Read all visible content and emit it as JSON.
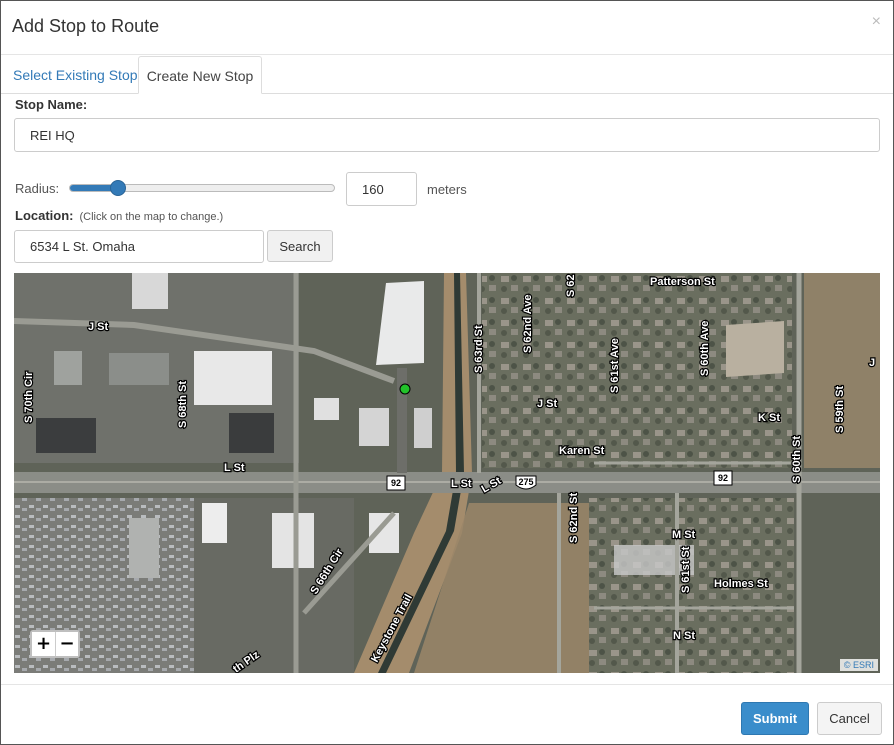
{
  "dialog": {
    "title": "Add Stop to Route",
    "close_glyph": "×"
  },
  "tabs": [
    {
      "label": "Select Existing Stop",
      "active": false
    },
    {
      "label": "Create New Stop",
      "active": true
    }
  ],
  "form": {
    "stop_name_label": "Stop Name:",
    "stop_name_value": "REI HQ",
    "radius_label": "Radius:",
    "radius_value": "160",
    "radius_fraction": 0.16,
    "radius_unit": "meters",
    "location_label": "Location:",
    "location_hint": "(Click on the map to change.)",
    "location_value": "6534 L St. Omaha",
    "search_label": "Search"
  },
  "map": {
    "zoom_in": "+",
    "zoom_out": "−",
    "attribution": "© ESRI",
    "marker_color": "#22c22a",
    "street_labels": {
      "j_st": "J St",
      "s70th": "S 70th Cir",
      "s68th": "S 68th St",
      "l_st_w": "L St",
      "l_st_e": "L St",
      "l_st_e2": "L St",
      "s63rd": "S 63rd St",
      "s62nd_ave": "S 62nd Ave",
      "s62": "S 62",
      "patterson": "Patterson St",
      "j_st_e": "J St",
      "s61st_ave": "S 61st Ave",
      "s60th_ave": "S 60th Ave",
      "k_st": "K St",
      "s59th": "S 59th St",
      "j_far": "J",
      "karen": "Karen St",
      "s60th": "S 60th St",
      "s62nd": "S 62nd St",
      "m_st": "M St",
      "s61st": "S 61st St",
      "holmes": "Holmes St",
      "n_st": "N St",
      "s66th_cir": "S 66th Cir",
      "keystone": "Keystone Trail",
      "th_plz": "th Plz"
    },
    "shields": {
      "us92a": "92",
      "us275": "275",
      "us92b": "92"
    }
  },
  "footer": {
    "submit_label": "Submit",
    "cancel_label": "Cancel"
  },
  "colors": {
    "accent": "#3a8dcb",
    "link": "#337ab7"
  }
}
